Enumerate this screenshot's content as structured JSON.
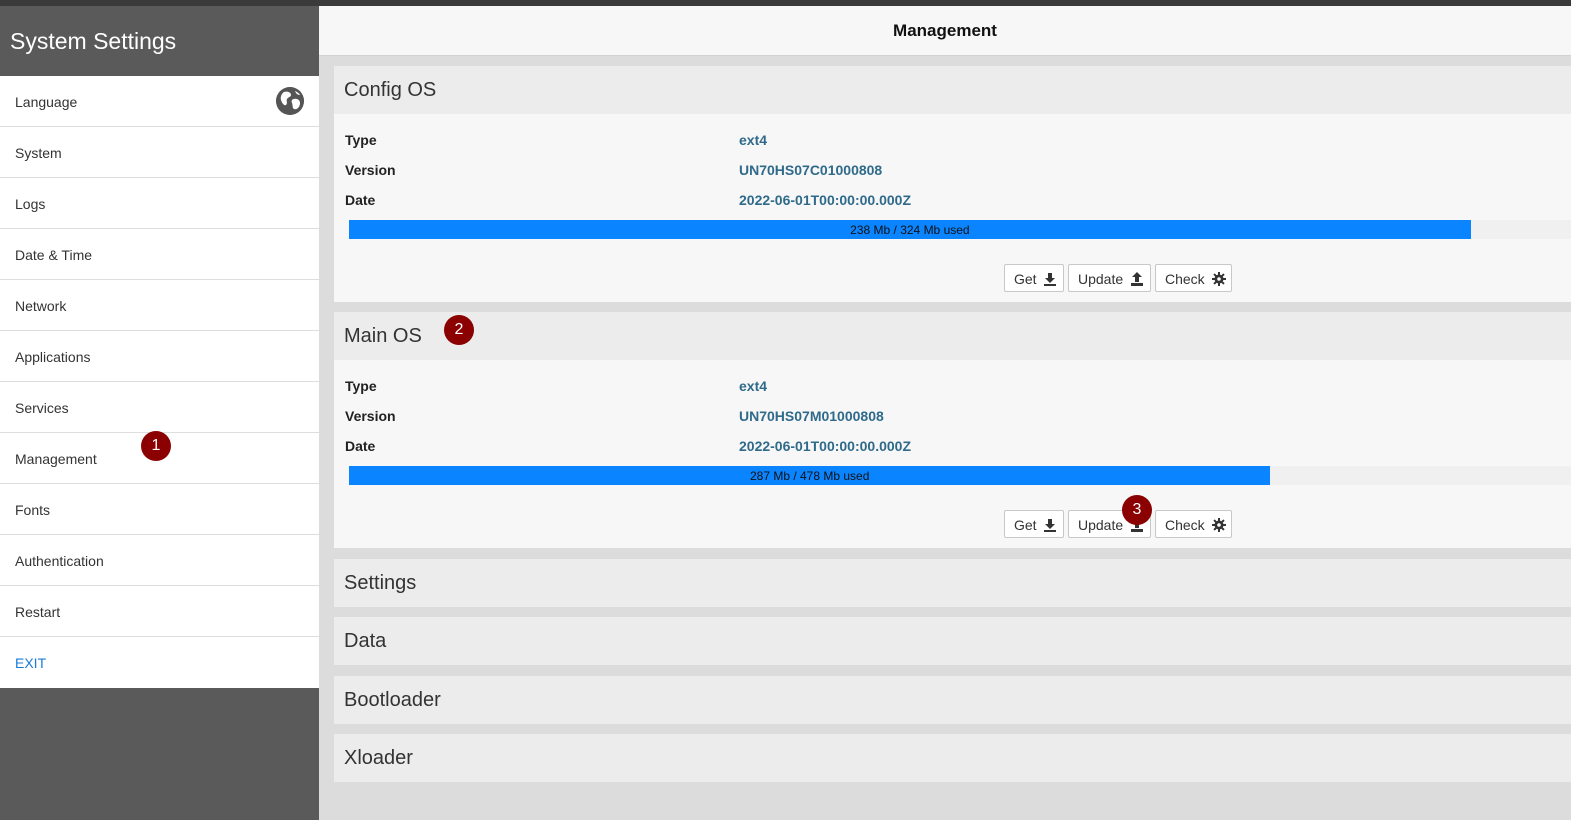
{
  "sidebar": {
    "title": "System Settings",
    "items": [
      {
        "label": "Language"
      },
      {
        "label": "System"
      },
      {
        "label": "Logs"
      },
      {
        "label": "Date & Time"
      },
      {
        "label": "Network"
      },
      {
        "label": "Applications"
      },
      {
        "label": "Services"
      },
      {
        "label": "Management"
      },
      {
        "label": "Fonts"
      },
      {
        "label": "Authentication"
      },
      {
        "label": "Restart"
      },
      {
        "label": "EXIT"
      }
    ]
  },
  "main": {
    "title": "Management",
    "config_os": {
      "title": "Config OS",
      "type_label": "Type",
      "type_value": "ext4",
      "version_label": "Version",
      "version_value": "UN70HS07C01000808",
      "date_label": "Date",
      "date_value": "2022-06-01T00:00:00.000Z",
      "usage_text": "238 Mb / 324 Mb used",
      "usage_fraction": 0.918
    },
    "main_os": {
      "title": "Main OS",
      "type_label": "Type",
      "type_value": "ext4",
      "version_label": "Version",
      "version_value": "UN70HS07M01000808",
      "date_label": "Date",
      "date_value": "2022-06-01T00:00:00.000Z",
      "usage_text": "287 Mb / 478 Mb used",
      "usage_fraction": 0.754
    },
    "buttons": {
      "get": "Get",
      "update": "Update",
      "check": "Check"
    },
    "collapsed_sections": {
      "settings": "Settings",
      "data": "Data",
      "bootloader": "Bootloader",
      "xloader": "Xloader"
    }
  },
  "markers": {
    "one": "1",
    "two": "2",
    "three": "3"
  },
  "colors": {
    "accent": "#0a84ff",
    "marker": "#8b0000",
    "value_text": "#2f6a8a",
    "exit_link": "#1a7bd9"
  },
  "icons": {
    "language": "globe-icon",
    "get": "download-icon",
    "update": "upload-icon",
    "check": "gear-icon"
  }
}
